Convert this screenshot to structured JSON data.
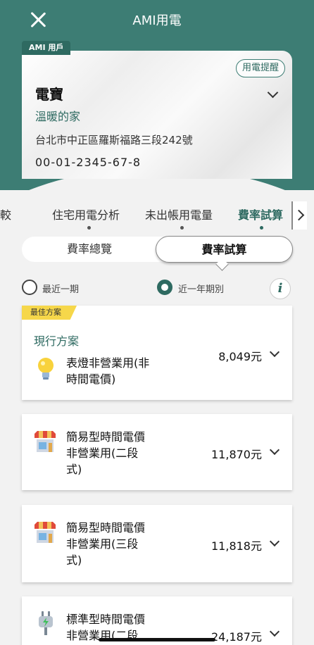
{
  "header": {
    "title": "AMI用電",
    "close_icon": "close-icon"
  },
  "account": {
    "tag": "AMI 用戶",
    "alert_button": "用電提醒",
    "name": "電寶",
    "nickname": "溫暖的家",
    "address": "台北市中正區羅斯福路三段242號",
    "number": "00-01-2345-67-8"
  },
  "tabs": [
    {
      "label": "比較",
      "active": false
    },
    {
      "label": "住宅用電分析",
      "active": false
    },
    {
      "label": "未出帳用電量",
      "active": false
    },
    {
      "label": "費率試算",
      "active": true
    }
  ],
  "segment": {
    "left": "費率總覽",
    "right": "費率試算"
  },
  "period": {
    "option1": "最近一期",
    "option2": "近一年期別",
    "selected": "option2"
  },
  "plans": [
    {
      "badge": "最佳方案",
      "current": "現行方案",
      "name_line1": "表燈非營業用(非",
      "name_line2": "時間電價)",
      "name_line3": "",
      "price": "8,049元",
      "icon": "lightbulb-icon"
    },
    {
      "name_line1": "簡易型時間電價",
      "name_line2": "非營業用(二段",
      "name_line3": "式)",
      "price": "11,870元",
      "icon": "shop-icon"
    },
    {
      "name_line1": "簡易型時間電價",
      "name_line2": "非營業用(三段",
      "name_line3": "式)",
      "price": "11,818元",
      "icon": "shop-icon"
    },
    {
      "name_line1": "標準型時間電價",
      "name_line2": "非營業用(二段",
      "name_line3": "",
      "price": "24,187元",
      "icon": "plug-icon"
    }
  ],
  "colors": {
    "brand": "#3d7d74",
    "badge": "#f6d74a"
  }
}
